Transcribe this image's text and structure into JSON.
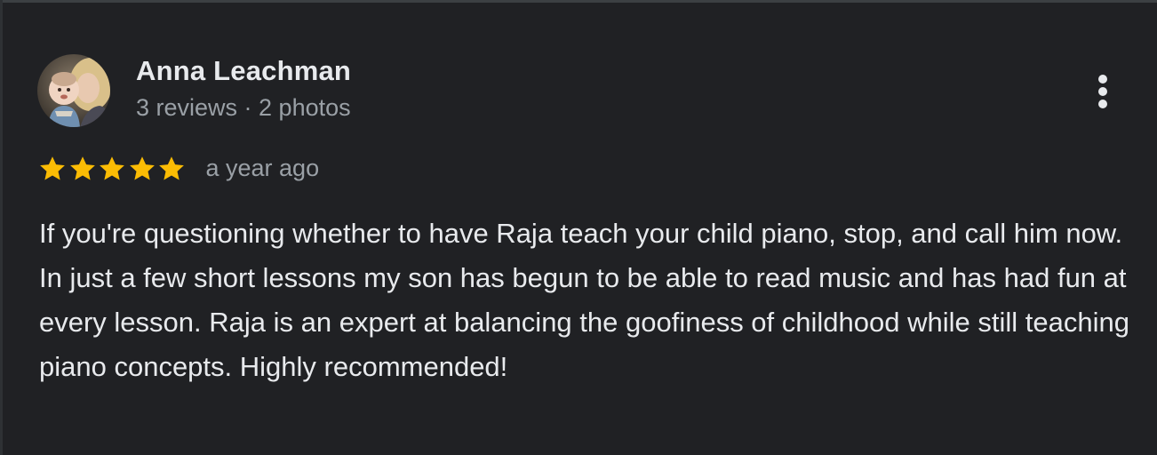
{
  "review": {
    "author": {
      "name": "Anna Leachman",
      "meta": "3 reviews · 2 photos",
      "avatar_icon": "profile-photo"
    },
    "rating": {
      "stars": 5,
      "max": 5,
      "star_color": "#fbbc04"
    },
    "time": "a year ago",
    "text": "If you're questioning whether to have Raja teach your child piano, stop, and call him now. In just a few short lessons my son has begun to be able to read music and has had fun at every lesson. Raja is an expert at balancing the goofiness of childhood while still teaching piano concepts. Highly recommended!",
    "more_icon": "more-vert-icon"
  },
  "theme": {
    "background": "#202124",
    "primary_text": "#e8eaed",
    "secondary_text": "#9aa0a6"
  }
}
